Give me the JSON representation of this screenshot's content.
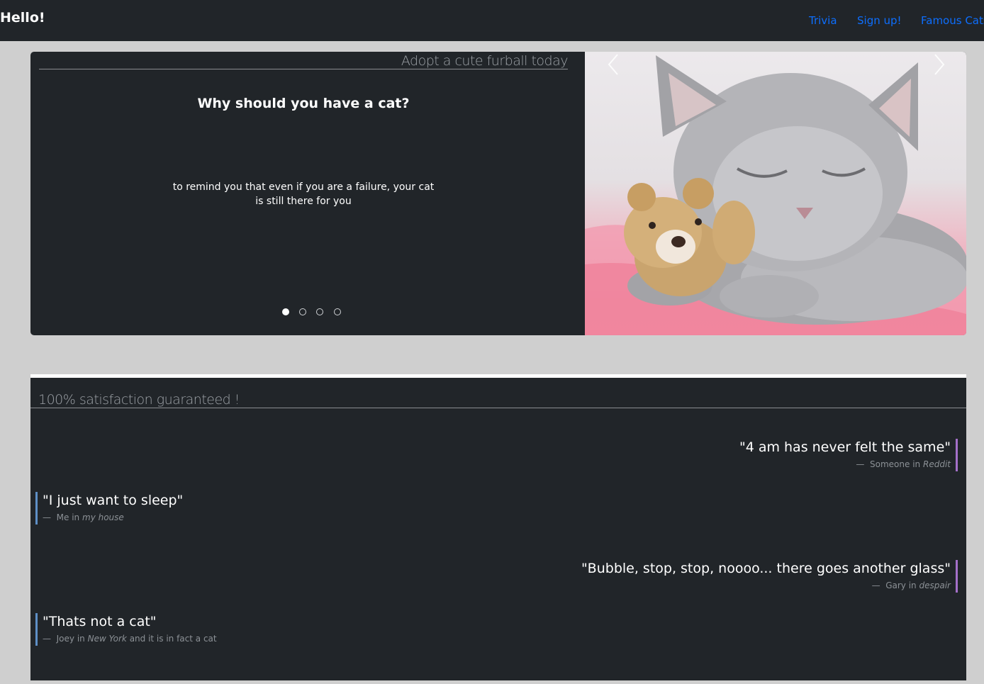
{
  "navbar": {
    "brand": "Hello!",
    "links": [
      "Trivia",
      "Sign up!",
      "Famous Cats"
    ],
    "link_color": "#0d6efd"
  },
  "hero": {
    "header": "Adopt a cute furball today",
    "question": "Why should you have a cat?",
    "answer": "to remind you that even if you are a failure, your cat is still there for you",
    "slide_count": 4,
    "active_slide": 1,
    "prev_icon": "chevron-left-icon",
    "next_icon": "chevron-right-icon",
    "image": "sleeping grey kitten hugging a teddy bear"
  },
  "testimonials": {
    "header": "100% satisfaction guaranteed !",
    "quotes": [
      {
        "text": "\"4 am has never felt the same\"",
        "dash": "—",
        "author": "Someone",
        "in": "in",
        "place": "Reddit",
        "extra": "",
        "align": "right"
      },
      {
        "text": "\"I just want to sleep\"",
        "dash": "—",
        "author": "Me",
        "in": "in",
        "place": "my house",
        "extra": "",
        "align": "left"
      },
      {
        "text": "\"Bubble, stop, stop, noooo... there goes another glass\"",
        "dash": "—",
        "author": "Gary",
        "in": "in",
        "place": "despair",
        "extra": "",
        "align": "right"
      },
      {
        "text": "\"Thats not a cat\"",
        "dash": "—",
        "author": "Joey",
        "in": "in",
        "place": "New York",
        "extra": "and it is in fact a cat",
        "align": "left"
      }
    ]
  },
  "colors": {
    "dark_bg": "#212529",
    "page_bg": "#cfcfcf",
    "accent_right": "#a470c9",
    "accent_left": "#5e8fc6"
  }
}
